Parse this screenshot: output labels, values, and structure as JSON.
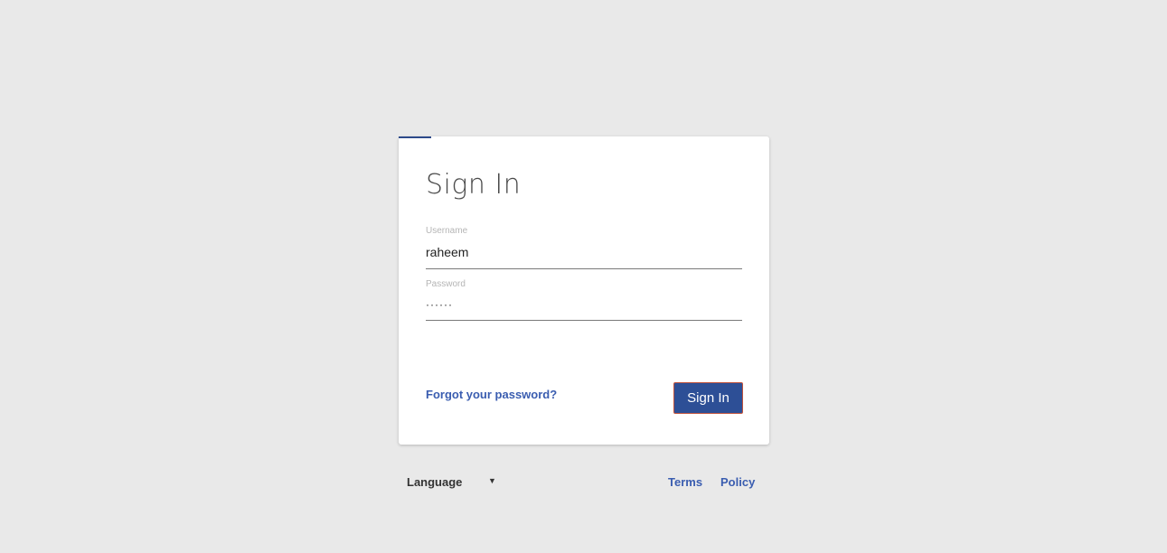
{
  "login": {
    "title": "Sign In",
    "username": {
      "label": "Username",
      "value": "raheem"
    },
    "password": {
      "label": "Password",
      "value": "······"
    },
    "forgot_password": "Forgot your password?",
    "submit_label": "Sign In"
  },
  "footer": {
    "language_label": "Language",
    "language_icon": "▼",
    "links": {
      "terms": "Terms",
      "policy": "Policy"
    }
  },
  "colors": {
    "background": "#e9e9e9",
    "accent": "#2d4a8a",
    "button": "#2d4f96",
    "button_border": "#c0533d",
    "link": "#3a5db0"
  },
  "icons": {
    "language_dropdown": "chevron-down-icon"
  }
}
